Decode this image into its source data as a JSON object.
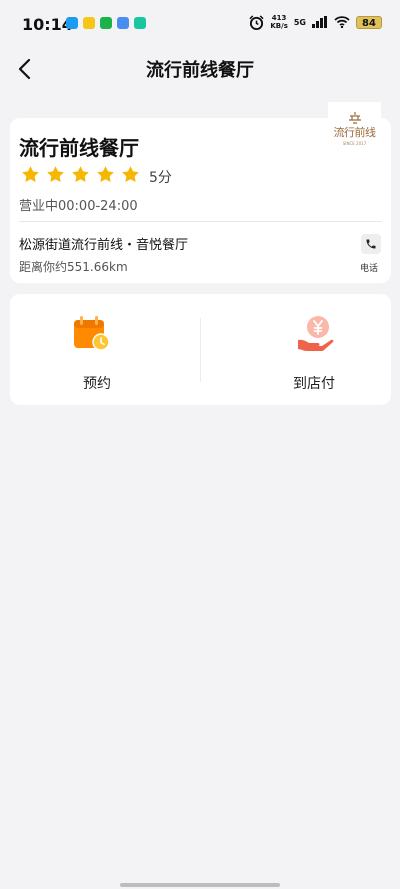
{
  "status_bar": {
    "time": "10:14",
    "net_speed_value": "413",
    "net_speed_unit": "KB/s",
    "network": "5G",
    "battery": "84",
    "notif_colors": [
      "#1e9bf0",
      "#f5c518",
      "#19b34a",
      "#4a8df0",
      "#18c7a0"
    ]
  },
  "nav": {
    "title": "流行前线餐厅",
    "back_icon": "chevron-left-icon"
  },
  "restaurant": {
    "name": "流行前线餐厅",
    "logo_text": "流行前线",
    "logo_sub": "SINCE 2017",
    "rating": 5,
    "rating_max": 5,
    "score_text": "5分",
    "hours": "营业中00:00-24:00",
    "address": "松源街道流行前线・音悦餐厅",
    "distance": "距离你约551.66km",
    "phone_label": "电话",
    "star_color": "#f5b700"
  },
  "actions": [
    {
      "label": "预约",
      "icon": "calendar-clock-icon"
    },
    {
      "label": "到店付",
      "icon": "hand-yen-icon"
    }
  ]
}
